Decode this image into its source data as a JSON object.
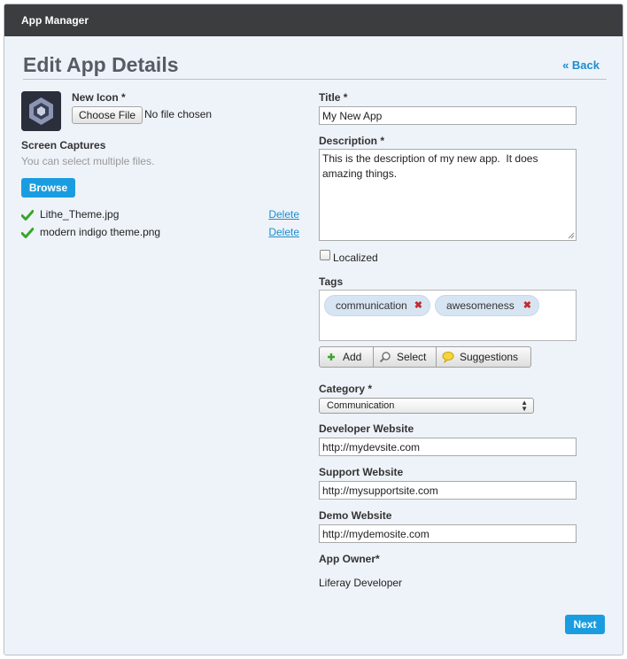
{
  "window": {
    "title": "App Manager"
  },
  "header": {
    "title": "Edit App Details",
    "back_label": "« Back"
  },
  "icon_section": {
    "label": "New Icon *",
    "choose_file_label": "Choose File",
    "no_file_text": "No file chosen"
  },
  "screen_captures": {
    "label": "Screen Captures",
    "hint": "You can select multiple files.",
    "browse_label": "Browse",
    "files": [
      {
        "name": "Lithe_Theme.jpg",
        "delete_label": "Delete"
      },
      {
        "name": "modern indigo theme.png",
        "delete_label": "Delete"
      }
    ]
  },
  "form": {
    "title_label": "Title *",
    "title_value": "My New App",
    "description_label": "Description *",
    "description_value": "This is the description of my new app.  It does amazing things.",
    "localized_label": "Localized",
    "localized_checked": false,
    "tags_label": "Tags",
    "tags": [
      {
        "label": "communication"
      },
      {
        "label": "awesomeness"
      }
    ],
    "tag_actions": {
      "add": "Add",
      "select": "Select",
      "suggestions": "Suggestions"
    },
    "category_label": "Category *",
    "category_value": "Communication",
    "developer_website_label": "Developer Website",
    "developer_website_value": "http://mydevsite.com",
    "support_website_label": "Support Website",
    "support_website_value": "http://mysupportsite.com",
    "demo_website_label": "Demo Website",
    "demo_website_value": "http://mydemosite.com",
    "app_owner_label": "App Owner*",
    "app_owner_value": "Liferay Developer"
  },
  "footer": {
    "next_label": "Next"
  },
  "colors": {
    "title_bar": "#3c3d3e",
    "panel_background": "#eef3f9",
    "accent_button": "#1a9de0",
    "link": "#1a8fd1",
    "tag_background": "#d7e5f3",
    "tag_remove": "#c32b2b"
  }
}
